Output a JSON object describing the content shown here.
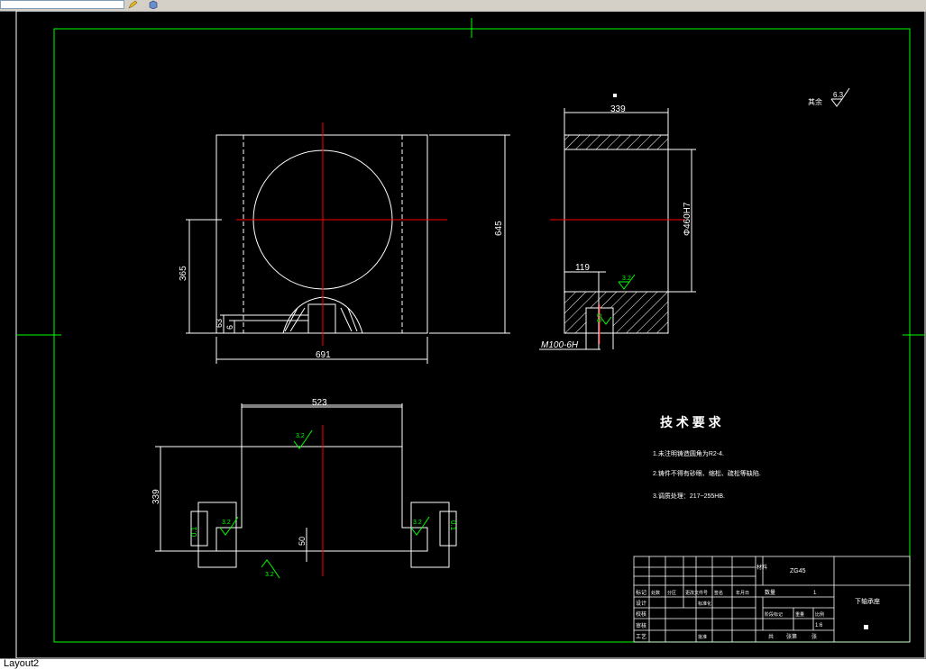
{
  "layout_tab": "Layout2",
  "drawing": {
    "front_view": {
      "dim_width": "691",
      "dim_height": "645",
      "dim_center_height": "365",
      "dim_small_1": "63",
      "dim_small_2": "6"
    },
    "side_view": {
      "dim_top": "339",
      "dim_bore": "Φ460H7",
      "dim_offset": "119",
      "dim_thread": "M100-6H",
      "roughness_1": "3.2",
      "roughness_2": "6.3"
    },
    "bottom_view": {
      "dim_width": "523",
      "dim_height": "339",
      "dim_base": "50",
      "roughness_top": "3.2",
      "roughness_left": "3.2",
      "roughness_right": "3.2",
      "roughness_bottom": "3.2",
      "tol_left": "0.1",
      "tol_right": "0.1"
    },
    "roughness_note": {
      "label": "其余",
      "value": "6.3"
    },
    "tech_requirements": {
      "title": "技 术 要 求",
      "items": [
        "1.未注明铸造圆角为R2-4.",
        "2.铸件不得有砂眼、缩松、疏松等缺陷.",
        "3.调质处理：217~255HB."
      ]
    },
    "title_block": {
      "material_label": "材料",
      "material_value": "ZG45",
      "part_name": "下轴承座",
      "scale": "1:6",
      "qty": "1",
      "row_labels": [
        "标记",
        "设计",
        "校核",
        "审核",
        "工艺"
      ],
      "col_labels": [
        "处数",
        "分区",
        "更改文件号",
        "签名",
        "年月日"
      ],
      "extra": [
        "标准化",
        "批准",
        "阶段标记",
        "重量",
        "比例",
        "共",
        "张第",
        "张",
        "数量"
      ]
    }
  },
  "colors": {
    "frame": "#00ff00",
    "line": "#ffffff",
    "center": "#ff0000",
    "roughness": "#00ff00"
  }
}
